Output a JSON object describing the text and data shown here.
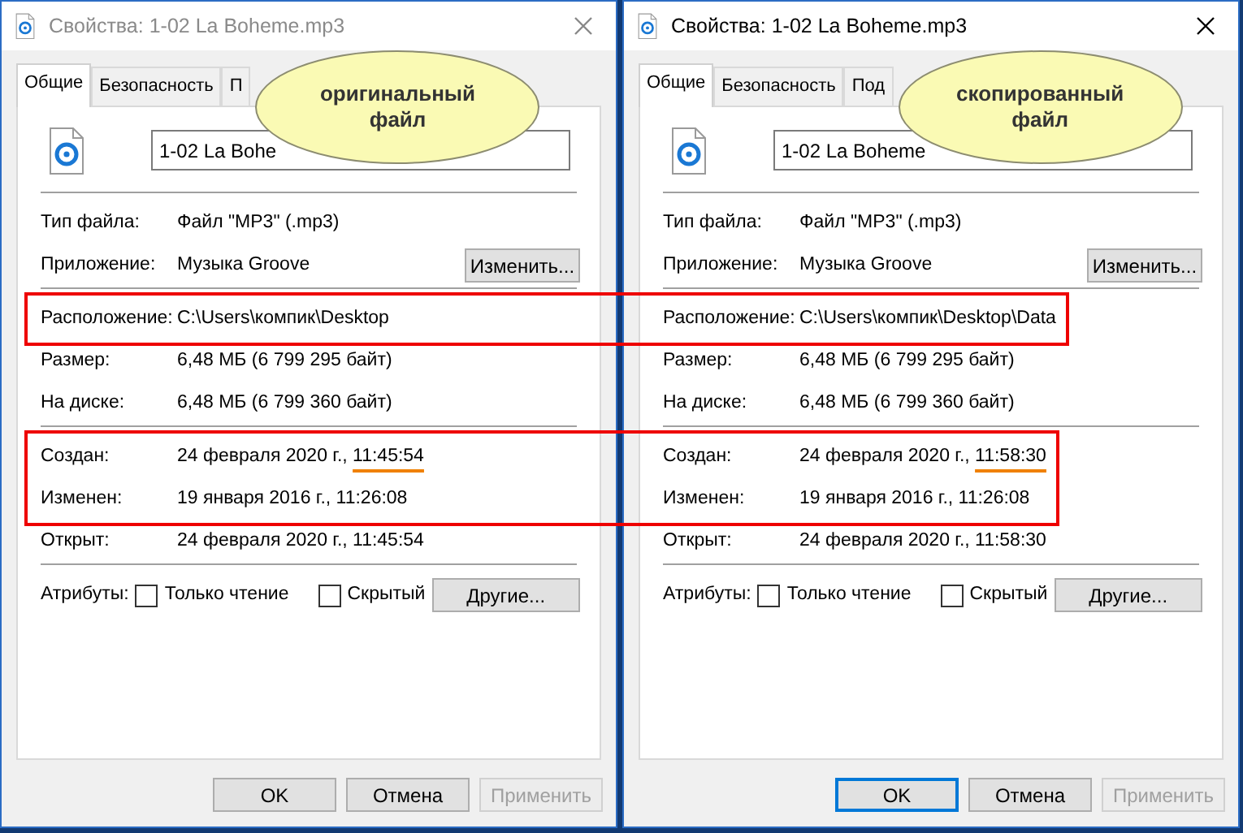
{
  "windows": [
    {
      "title": "Свойства: 1-02 La Boheme.mp3",
      "active": false,
      "tabs": [
        {
          "label": "Общие",
          "selected": true
        },
        {
          "label": "Безопасность",
          "selected": false
        },
        {
          "label": "П",
          "selected": false
        }
      ],
      "file_name": "1-02 La Bohe",
      "callout": "оригинальный файл",
      "sections": [
        [
          {
            "label": "Тип файла:",
            "value": "Файл \"MP3\" (.mp3)",
            "framed": false
          },
          {
            "label": "Приложение:",
            "value": "Музыка Groove",
            "button": "Изменить...",
            "framed": false
          }
        ],
        [
          {
            "label": "Расположение:",
            "value": "C:\\Users\\компик\\Desktop",
            "framed": true
          },
          {
            "label": "Размер:",
            "value": "6,48 МБ (6 799 295 байт)",
            "framed": false
          },
          {
            "label": "На диске:",
            "value": "6,48 МБ (6 799 360 байт)",
            "framed": false
          }
        ],
        [
          {
            "label": "Создан:",
            "value": "24 февраля 2020 г.,",
            "time": "11:45:54",
            "underlined": true,
            "framed": true
          },
          {
            "label": "Изменен:",
            "value": "19 января 2016 г., 11:26:08",
            "framed": true
          },
          {
            "label": "Открыт:",
            "value": "24 февраля 2020 г., 11:45:54",
            "framed": false
          }
        ]
      ],
      "attributes": {
        "label": "Атрибуты:",
        "checkboxes": [
          {
            "label": "Только чтение",
            "checked": false
          },
          {
            "label": "Скрытый",
            "checked": false
          }
        ],
        "button": "Другие..."
      },
      "buttons": [
        {
          "label": "OK",
          "disabled": false
        },
        {
          "label": "Отмена",
          "disabled": false
        },
        {
          "label": "Применить",
          "disabled": true
        }
      ]
    },
    {
      "title": "Свойства: 1-02 La Boheme.mp3",
      "active": true,
      "tabs": [
        {
          "label": "Общие",
          "selected": true
        },
        {
          "label": "Безопасность",
          "selected": false
        },
        {
          "label": "Под",
          "selected": false
        }
      ],
      "file_name": "1-02 La Boheme",
      "callout": "скопированный файл",
      "sections": [
        [
          {
            "label": "Тип файла:",
            "value": "Файл \"MP3\" (.mp3)",
            "framed": false
          },
          {
            "label": "Приложение:",
            "value": "Музыка Groove",
            "button": "Изменить...",
            "framed": false
          }
        ],
        [
          {
            "label": "Расположение:",
            "value": "C:\\Users\\компик\\Desktop\\Data",
            "framed": true
          },
          {
            "label": "Размер:",
            "value": "6,48 МБ (6 799 295 байт)",
            "framed": false
          },
          {
            "label": "На диске:",
            "value": "6,48 МБ (6 799 360 байт)",
            "framed": false
          }
        ],
        [
          {
            "label": "Создан:",
            "value": "24 февраля 2020 г.,",
            "time": "11:58:30",
            "underlined": true,
            "framed": true
          },
          {
            "label": "Изменен:",
            "value": "19 января 2016 г., 11:26:08",
            "framed": true
          },
          {
            "label": "Открыт:",
            "value": "24 февраля 2020 г., 11:58:30",
            "framed": false
          }
        ]
      ],
      "attributes": {
        "label": "Атрибуты:",
        "checkboxes": [
          {
            "label": "Только чтение",
            "checked": false
          },
          {
            "label": "Скрытый",
            "checked": false
          }
        ],
        "button": "Другие..."
      },
      "buttons": [
        {
          "label": "OK",
          "disabled": false
        },
        {
          "label": "Отмена",
          "disabled": false
        },
        {
          "label": "Применить",
          "disabled": true
        }
      ]
    }
  ]
}
